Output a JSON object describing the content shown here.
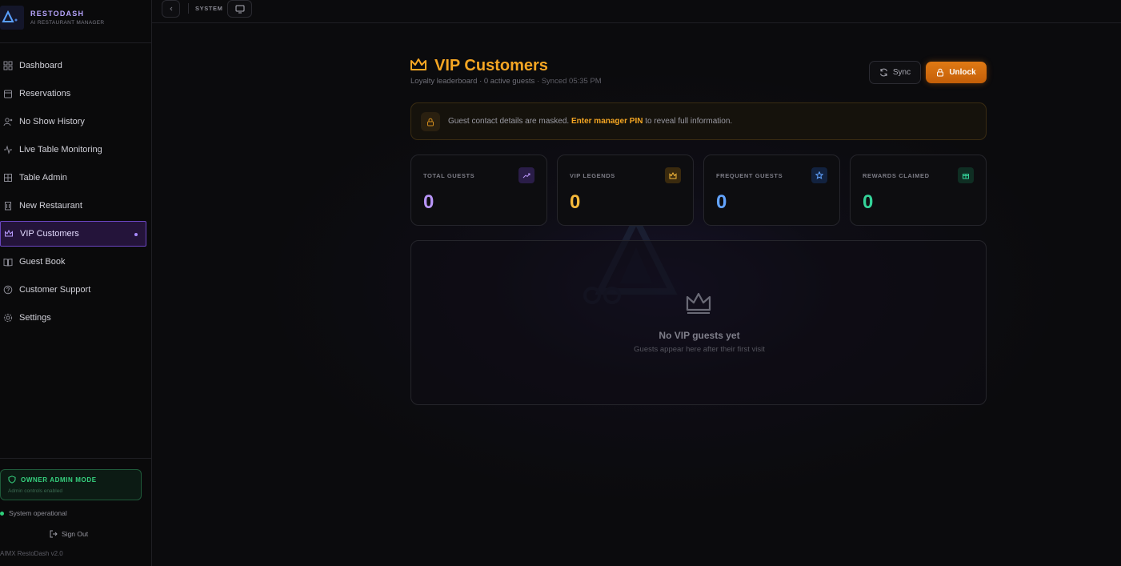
{
  "brand": {
    "name": "RESTODASH",
    "subtitle": "AI RESTAURANT MANAGER"
  },
  "sidebar": {
    "items": [
      {
        "label": "Dashboard",
        "icon": "grid-icon"
      },
      {
        "label": "Reservations",
        "icon": "calendar-icon"
      },
      {
        "label": "No Show History",
        "icon": "user-x-icon"
      },
      {
        "label": "Live Table Monitoring",
        "icon": "activity-icon"
      },
      {
        "label": "Table Admin",
        "icon": "table-icon"
      },
      {
        "label": "New Restaurant",
        "icon": "building-icon"
      },
      {
        "label": "VIP Customers",
        "icon": "crown-icon",
        "active": true
      },
      {
        "label": "Guest Book",
        "icon": "book-icon"
      },
      {
        "label": "Customer Support",
        "icon": "help-icon"
      },
      {
        "label": "Settings",
        "icon": "gear-icon"
      }
    ],
    "admin_mode": {
      "title": "OWNER ADMIN MODE",
      "subtitle": "Admin controls enabled"
    },
    "status": "System operational",
    "sign_out": "Sign Out",
    "version": "AIMX RestoDash v2.0"
  },
  "topbar": {
    "label": "SYSTEM"
  },
  "header": {
    "title": "VIP Customers",
    "subtitle": "Loyalty leaderboard · 0 active guests",
    "synced": "· Synced 05:35 PM",
    "sync_label": "Sync",
    "unlock_label": "Unlock"
  },
  "notice": {
    "before": "Guest contact details are masked.",
    "link": "Enter manager PIN",
    "after": "to reveal full information."
  },
  "stats": [
    {
      "label": "TOTAL GUESTS",
      "value": "0",
      "color": "#b794f6",
      "icon": "trending-up-icon"
    },
    {
      "label": "VIP LEGENDS",
      "value": "0",
      "color": "#f6b93b",
      "icon": "crown-icon"
    },
    {
      "label": "FREQUENT GUESTS",
      "value": "0",
      "color": "#63a4ff",
      "icon": "star-icon"
    },
    {
      "label": "REWARDS CLAIMED",
      "value": "0",
      "color": "#34d399",
      "icon": "gift-icon"
    }
  ],
  "empty_state": {
    "title": "No VIP guests yet",
    "subtitle": "Guests appear here after their first visit"
  },
  "colors": {
    "accent": "#f5a623",
    "primary": "#6b46c1",
    "success": "#2ecf7a"
  }
}
